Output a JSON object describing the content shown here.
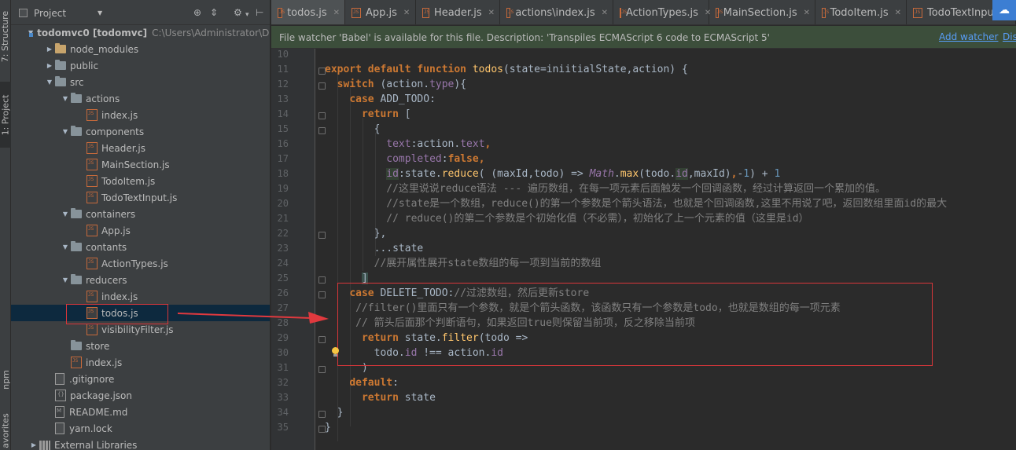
{
  "toolstrip": {
    "structure_label": "7: Structure",
    "project_label": "1: Project",
    "npm_label": "npm",
    "favorites_label": "avorites"
  },
  "project_panel": {
    "title": "Project",
    "tree": [
      {
        "label": "todomvc0 [todomvc]",
        "path": "C:\\Users\\Administrator\\De",
        "kind": "module",
        "arrow": "down"
      },
      {
        "label": "node_modules",
        "kind": "folder-excluded",
        "arrow": "right"
      },
      {
        "label": "public",
        "kind": "folder",
        "arrow": "right"
      },
      {
        "label": "src",
        "kind": "folder",
        "arrow": "down"
      },
      {
        "label": "actions",
        "kind": "folder",
        "arrow": "down"
      },
      {
        "label": "index.js",
        "kind": "js"
      },
      {
        "label": "components",
        "kind": "folder",
        "arrow": "down"
      },
      {
        "label": "Header.js",
        "kind": "js"
      },
      {
        "label": "MainSection.js",
        "kind": "js"
      },
      {
        "label": "TodoItem.js",
        "kind": "js"
      },
      {
        "label": "TodoTextInput.js",
        "kind": "js"
      },
      {
        "label": "containers",
        "kind": "folder",
        "arrow": "down"
      },
      {
        "label": "App.js",
        "kind": "js"
      },
      {
        "label": "contants",
        "kind": "folder",
        "arrow": "down"
      },
      {
        "label": "ActionTypes.js",
        "kind": "js"
      },
      {
        "label": "reducers",
        "kind": "folder",
        "arrow": "down"
      },
      {
        "label": "index.js",
        "kind": "js"
      },
      {
        "label": "todos.js",
        "kind": "js",
        "selected": true
      },
      {
        "label": "visibilityFilter.js",
        "kind": "js"
      },
      {
        "label": "store",
        "kind": "folder",
        "arrow": "none"
      },
      {
        "label": "index.js",
        "kind": "js"
      },
      {
        "label": ".gitignore",
        "kind": "file"
      },
      {
        "label": "package.json",
        "kind": "json"
      },
      {
        "label": "README.md",
        "kind": "md"
      },
      {
        "label": "yarn.lock",
        "kind": "file"
      },
      {
        "label": "External Libraries",
        "kind": "lib",
        "arrow": "right"
      }
    ]
  },
  "tabs": [
    {
      "label": "todos.js",
      "active": true
    },
    {
      "label": "App.js"
    },
    {
      "label": "Header.js"
    },
    {
      "label": "actions\\index.js"
    },
    {
      "label": "ActionTypes.js"
    },
    {
      "label": "MainSection.js"
    },
    {
      "label": "TodoItem.js"
    },
    {
      "label": "TodoTextInpu"
    }
  ],
  "notification": {
    "message": "File watcher 'Babel' is available for this file. Description: 'Transpiles ECMAScript 6 code to ECMAScript 5'",
    "add_watcher": "Add watcher",
    "dismiss": "Dis"
  },
  "editor": {
    "line_numbers": [
      "10",
      "11",
      "12",
      "13",
      "14",
      "15",
      "16",
      "17",
      "18",
      "19",
      "20",
      "21",
      "22",
      "23",
      "24",
      "25",
      "26",
      "27",
      "28",
      "29",
      "30",
      "31",
      "32",
      "33",
      "34",
      "35"
    ],
    "lines": [
      [],
      [
        {
          "t": "export default function ",
          "c": "kw"
        },
        {
          "t": "todos",
          "c": "fn"
        },
        {
          "t": "(state=iniitialState,action) {"
        }
      ],
      [
        {
          "t": "  "
        },
        {
          "t": "switch ",
          "c": "kw"
        },
        {
          "t": "(action."
        },
        {
          "t": "type",
          "c": "prop"
        },
        {
          "t": "){"
        }
      ],
      [
        {
          "t": "    "
        },
        {
          "t": "case ",
          "c": "kw"
        },
        {
          "t": "ADD_TODO:"
        }
      ],
      [
        {
          "t": "      "
        },
        {
          "t": "return ",
          "c": "kw"
        },
        {
          "t": "["
        }
      ],
      [
        {
          "t": "        {"
        }
      ],
      [
        {
          "t": "          "
        },
        {
          "t": "text",
          "c": "prop"
        },
        {
          "t": ":action."
        },
        {
          "t": "text",
          "c": "prop"
        },
        {
          "t": ",",
          "c": "kw"
        }
      ],
      [
        {
          "t": "          "
        },
        {
          "t": "completed",
          "c": "prop"
        },
        {
          "t": ":"
        },
        {
          "t": "false,",
          "c": "kw"
        }
      ],
      [
        {
          "t": "          "
        },
        {
          "t": "id",
          "c": "prop hl-id"
        },
        {
          "t": ":state."
        },
        {
          "t": "reduce",
          "c": "fn"
        },
        {
          "t": "( (maxId,todo) => "
        },
        {
          "t": "Math",
          "c": "prop ital"
        },
        {
          "t": "."
        },
        {
          "t": "max",
          "c": "fn"
        },
        {
          "t": "(todo."
        },
        {
          "t": "id",
          "c": "prop hl-id"
        },
        {
          "t": ",maxId)"
        },
        {
          "t": ",",
          "c": "kw"
        },
        {
          "t": "-"
        },
        {
          "t": "1",
          "c": "num"
        },
        {
          "t": ") + "
        },
        {
          "t": "1",
          "c": "num"
        }
      ],
      [
        {
          "t": "          "
        },
        {
          "t": "//这里说说reduce语法 --- 遍历数组，在每一项元素后面触发一个回调函数，经过计算返回一个累加的值。",
          "c": "cmt"
        }
      ],
      [
        {
          "t": "          "
        },
        {
          "t": "//state是一个数组，reduce()的第一个参数是个箭头语法，也就是个回调函数,这里不用说了吧，返回数组里面id的最大",
          "c": "cmt"
        }
      ],
      [
        {
          "t": "          "
        },
        {
          "t": "// reduce()的第二个参数是个初始化值（不必需），初始化了上一个元素的值（这里是id）",
          "c": "cmt"
        }
      ],
      [
        {
          "t": "        },"
        }
      ],
      [
        {
          "t": "        ...state"
        }
      ],
      [
        {
          "t": "        "
        },
        {
          "t": "//展开属性展开state数组的每一项到当前的数组",
          "c": "cmt"
        }
      ],
      [
        {
          "t": "      "
        },
        {
          "t": "]",
          "c": "brace-hl"
        }
      ],
      [
        {
          "t": "    "
        },
        {
          "t": "case ",
          "c": "kw"
        },
        {
          "t": "DELETE_TODO:"
        },
        {
          "t": "//过滤数组，然后更新store",
          "c": "cmt"
        }
      ],
      [
        {
          "t": "     "
        },
        {
          "t": "//filter()里面只有一个参数，就是个箭头函数，该函数只有一个参数是todo，也就是数组的每一项元素",
          "c": "cmt"
        }
      ],
      [
        {
          "t": "     "
        },
        {
          "t": "// 箭头后面那个判断语句，如果返回true则保留当前项，反之移除当前项",
          "c": "cmt"
        }
      ],
      [
        {
          "t": "      "
        },
        {
          "t": "return ",
          "c": "kw"
        },
        {
          "t": "state."
        },
        {
          "t": "filter",
          "c": "fn"
        },
        {
          "t": "(todo =>"
        }
      ],
      [
        {
          "t": "        todo."
        },
        {
          "t": "id",
          "c": "prop"
        },
        {
          "t": " !== action."
        },
        {
          "t": "id",
          "c": "prop"
        }
      ],
      [
        {
          "t": "      )"
        }
      ],
      [
        {
          "t": "    "
        },
        {
          "t": "default",
          "c": "kw"
        },
        {
          "t": ":"
        }
      ],
      [
        {
          "t": "      "
        },
        {
          "t": "return ",
          "c": "kw"
        },
        {
          "t": "state"
        }
      ],
      [
        {
          "t": "  }"
        }
      ],
      [
        {
          "t": "}"
        }
      ]
    ]
  }
}
